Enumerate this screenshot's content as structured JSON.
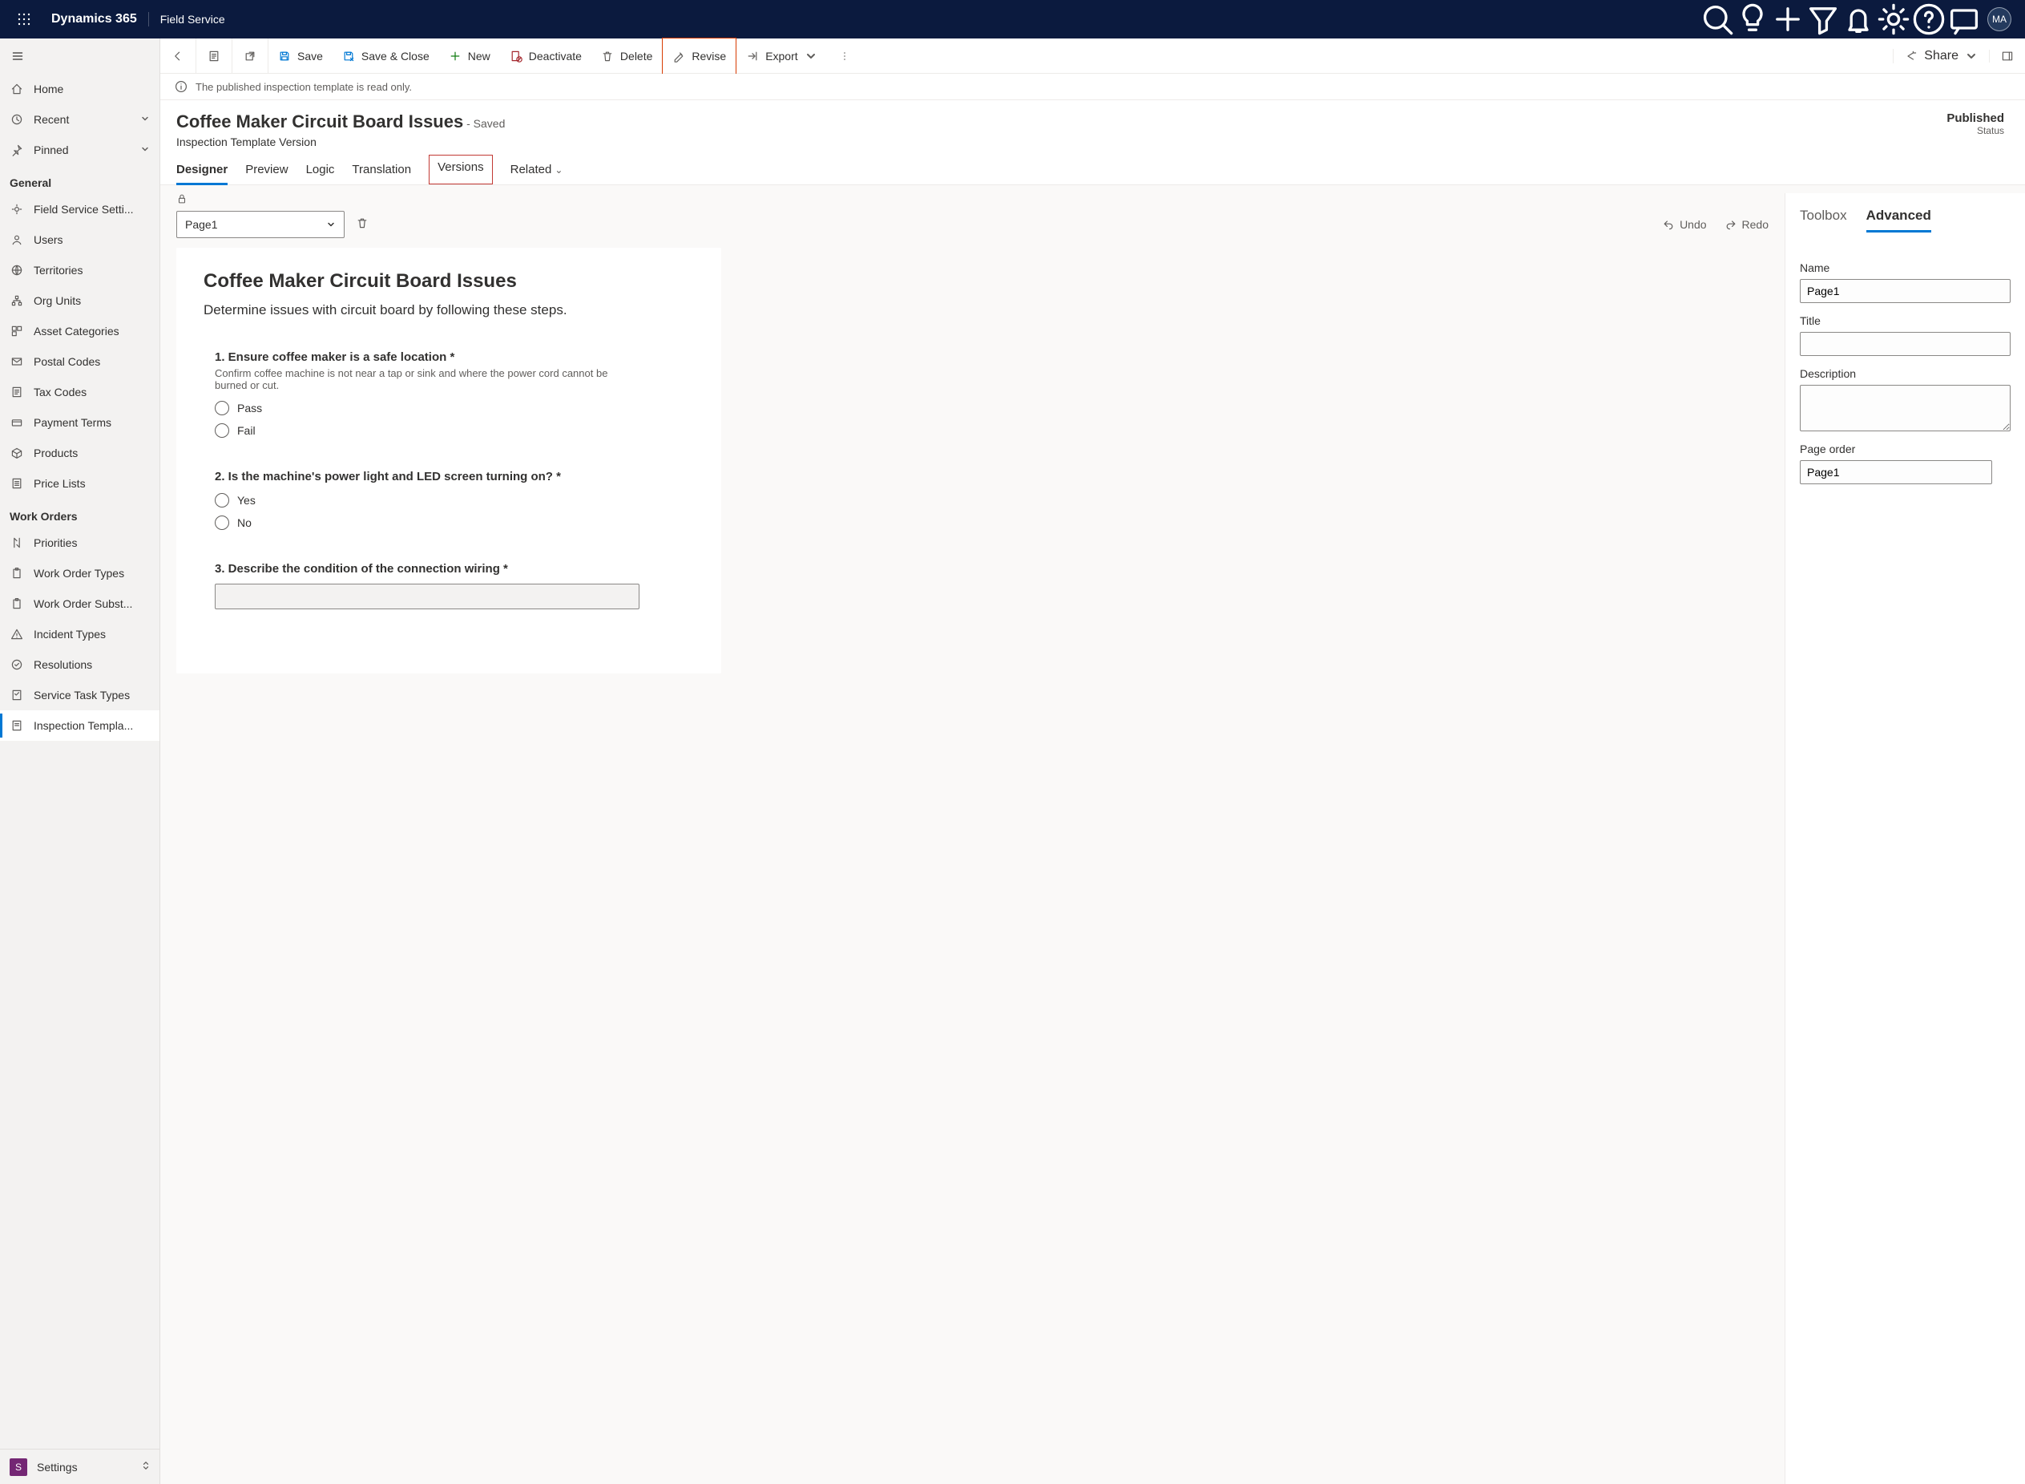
{
  "topbar": {
    "brand": "Dynamics 365",
    "area": "Field Service",
    "avatar": "MA"
  },
  "commands": {
    "save": "Save",
    "save_close": "Save & Close",
    "new": "New",
    "deactivate": "Deactivate",
    "delete": "Delete",
    "revise": "Revise",
    "export": "Export",
    "share": "Share"
  },
  "infostrip": "The published inspection template is read only.",
  "header": {
    "title": "Coffee Maker Circuit Board Issues",
    "saved": " - Saved",
    "subtitle": "Inspection Template Version",
    "status_value": "Published",
    "status_label": "Status"
  },
  "tabs": {
    "designer": "Designer",
    "preview": "Preview",
    "logic": "Logic",
    "translation": "Translation",
    "versions": "Versions",
    "related": "Related"
  },
  "leftnav": {
    "home": "Home",
    "recent": "Recent",
    "pinned": "Pinned",
    "section_general": "General",
    "field_service_settings": "Field Service Setti...",
    "users": "Users",
    "territories": "Territories",
    "org_units": "Org Units",
    "asset_categories": "Asset Categories",
    "postal_codes": "Postal Codes",
    "tax_codes": "Tax Codes",
    "payment_terms": "Payment Terms",
    "products": "Products",
    "price_lists": "Price Lists",
    "section_work_orders": "Work Orders",
    "priorities": "Priorities",
    "wo_types": "Work Order Types",
    "wo_subst": "Work Order Subst...",
    "incident_types": "Incident Types",
    "resolutions": "Resolutions",
    "service_task_types": "Service Task Types",
    "inspection_templates": "Inspection Templa...",
    "settings_letter": "S",
    "settings": "Settings"
  },
  "designer": {
    "page_selector": "Page1",
    "undo": "Undo",
    "redo": "Redo",
    "canvas_title": "Coffee Maker Circuit Board Issues",
    "canvas_desc": "Determine issues with circuit board by following these steps.",
    "q1_title": "1. Ensure coffee maker is a safe location *",
    "q1_help": "Confirm coffee machine is not near a tap or sink and where the power cord cannot be burned or cut.",
    "q1_opt1": "Pass",
    "q1_opt2": "Fail",
    "q2_title": "2. Is the machine's power light and LED screen turning on? *",
    "q2_opt1": "Yes",
    "q2_opt2": "No",
    "q3_title": "3. Describe the condition of the connection wiring *"
  },
  "props": {
    "tab_toolbox": "Toolbox",
    "tab_advanced": "Advanced",
    "name_label": "Name",
    "name_value": "Page1",
    "title_label": "Title",
    "title_value": "",
    "desc_label": "Description",
    "desc_value": "",
    "order_label": "Page order",
    "order_value": "Page1"
  }
}
